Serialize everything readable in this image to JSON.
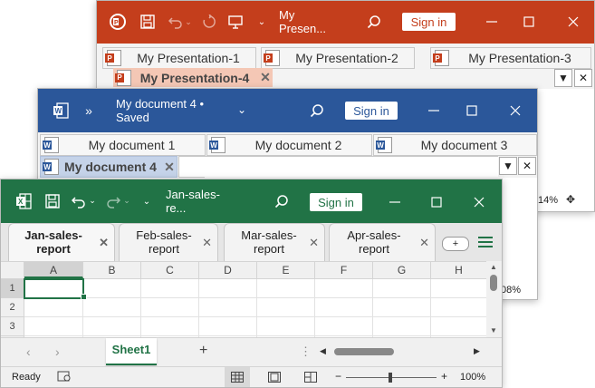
{
  "ppt": {
    "title": "My Presentation-4",
    "title_short": "My Presen...",
    "signin": "Sign in",
    "accent": "#c43e1c",
    "tabs": [
      {
        "label": "My Presentation-1",
        "active": false
      },
      {
        "label": "My Presentation-2",
        "active": false
      },
      {
        "label": "My Presentation-3",
        "active": false
      },
      {
        "label": "My Presentation-4",
        "active": true
      }
    ],
    "zoom_partial": "14%"
  },
  "word": {
    "title": "My document 4 • Saved",
    "signin": "Sign in",
    "accent": "#2b579a",
    "tabs": [
      {
        "label": "My document 1",
        "active": false
      },
      {
        "label": "My document 2",
        "active": false
      },
      {
        "label": "My document 3",
        "active": false
      },
      {
        "label": "My document 4",
        "active": true
      }
    ],
    "zoom_partial": "08%"
  },
  "excel": {
    "title": "Jan-sales-re...",
    "signin": "Sign in",
    "accent": "#217346",
    "tabs": [
      {
        "label": "Jan-sales-report",
        "line1": "Jan-sales-",
        "line2": "report",
        "active": true
      },
      {
        "label": "Feb-sales-report",
        "line1": "Feb-sales-",
        "line2": "report",
        "active": false
      },
      {
        "label": "Mar-sales-report",
        "line1": "Mar-sales-",
        "line2": "report",
        "active": false
      },
      {
        "label": "Apr-sales-report",
        "line1": "Apr-sales-",
        "line2": "report",
        "active": false
      }
    ],
    "columns": [
      "A",
      "B",
      "C",
      "D",
      "E",
      "F",
      "G",
      "H"
    ],
    "rows": [
      "1",
      "2",
      "3"
    ],
    "sheet": "Sheet1",
    "status": "Ready",
    "zoom": "100%"
  }
}
